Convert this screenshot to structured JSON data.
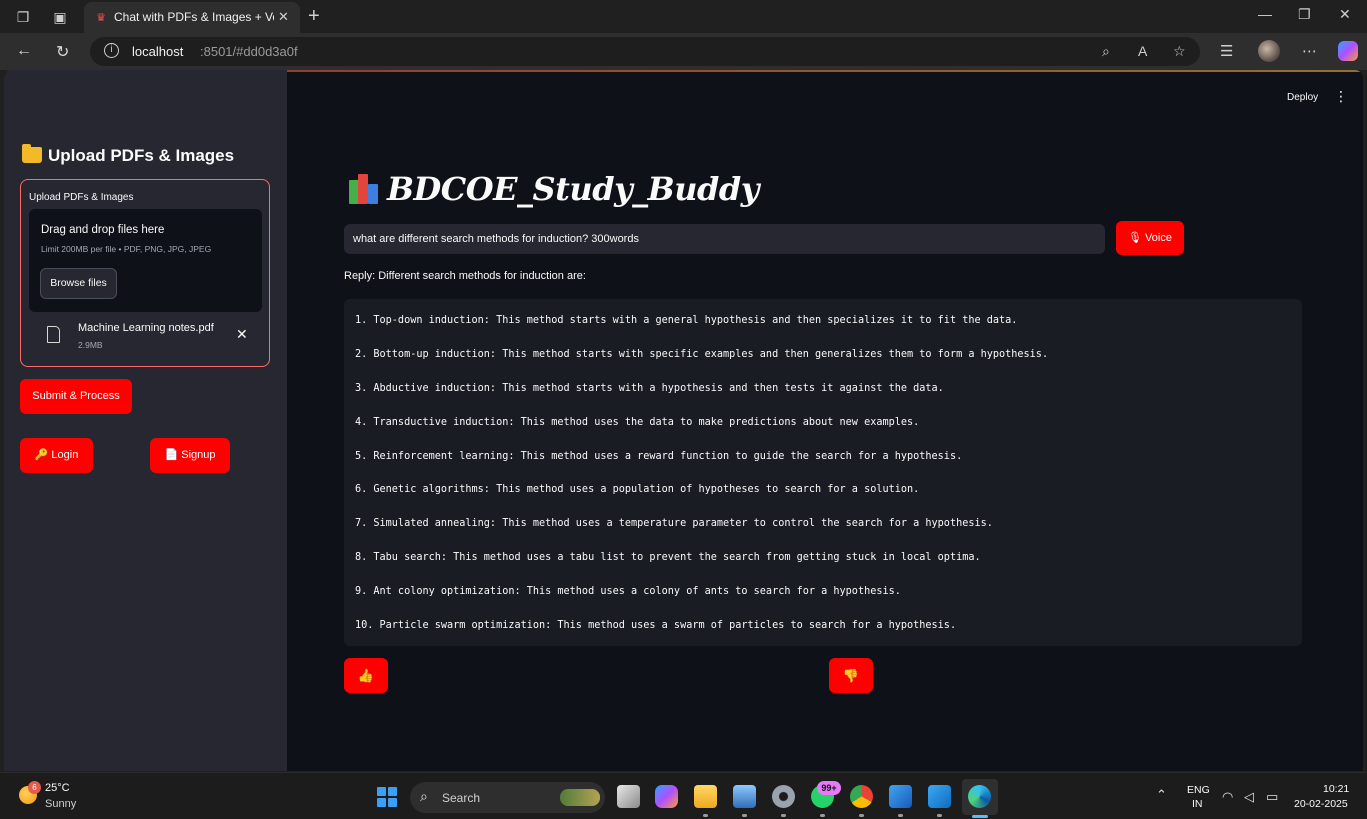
{
  "browser": {
    "tab_title": "Chat with PDFs & Images + Voice",
    "url_host": "localhost",
    "url_path": ":8501/#dd0d3a0f"
  },
  "sidebar": {
    "title": "Upload PDFs & Images",
    "uploader_label": "Upload PDFs & Images",
    "dropzone_title": "Drag and drop files here",
    "dropzone_limit": "Limit 200MB per file • PDF, PNG, JPG, JPEG",
    "browse_label": "Browse files",
    "file": {
      "name": "Machine Learning notes.pdf",
      "size": "2.9MB"
    },
    "submit_label": "Submit & Process",
    "login_label": "🔑 Login",
    "signup_label": "📄 Signup"
  },
  "header": {
    "deploy_label": "Deploy",
    "menu_icon": "⋮"
  },
  "main": {
    "title": "BDCOE_Study_Buddy",
    "question_value": "what are different search methods for induction? 300words",
    "voice_label": "🎙 Voice",
    "reply_label": "Reply: Different search methods for induction are:",
    "reply_lines": [
      "1. Top-down induction: This method starts with a general hypothesis and then specializes it to fit the data.",
      "2. Bottom-up induction: This method starts with specific examples and then generalizes them to form a hypothesis.",
      "3. Abductive induction: This method starts with a hypothesis and then tests it against the data.",
      "4. Transductive induction: This method uses the data to make predictions about new examples.",
      "5. Reinforcement learning: This method uses a reward function to guide the search for a hypothesis.",
      "6. Genetic algorithms: This method uses a population of hypotheses to search for a solution.",
      "7. Simulated annealing: This method uses a temperature parameter to control the search for a hypothesis.",
      "8. Tabu search: This method uses a tabu list to prevent the search from getting stuck in local optima.",
      "9. Ant colony optimization: This method uses a colony of ants to search for a hypothesis.",
      "10. Particle swarm optimization: This method uses a swarm of particles to search for a hypothesis."
    ],
    "thumbs_up": "👍",
    "thumbs_down": "👎"
  },
  "taskbar": {
    "temperature": "25°C",
    "condition": "Sunny",
    "weather_badge": "6",
    "search_label": "Search",
    "whatsapp_badge": "99+",
    "lang_line1": "ENG",
    "lang_line2": "IN",
    "time": "10:21",
    "date": "20-02-2025"
  },
  "colors": {
    "accent": "#ff0000",
    "app_bg": "#0e1117",
    "sidebar_bg": "#262730"
  }
}
